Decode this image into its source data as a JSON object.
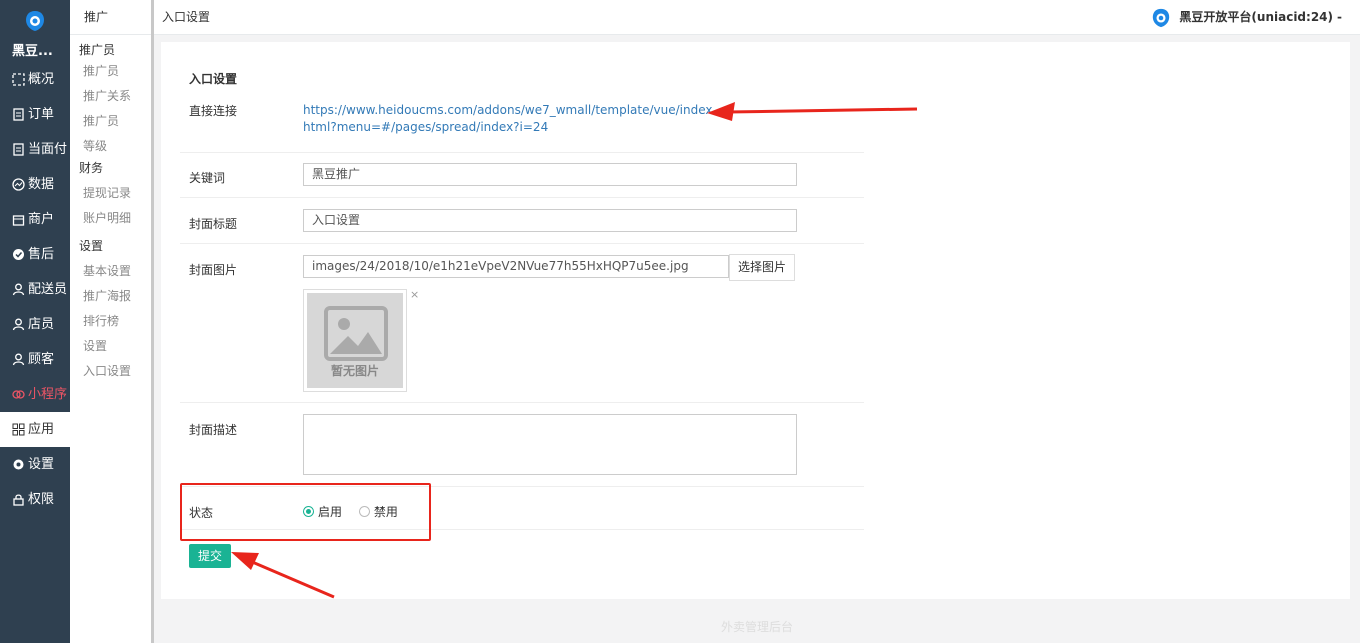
{
  "sidebar": {
    "brand": "黑豆...",
    "items": [
      {
        "label": "概况",
        "icon": "overview-icon"
      },
      {
        "label": "订单",
        "icon": "order-icon"
      },
      {
        "label": "当面付",
        "icon": "pay-icon"
      },
      {
        "label": "数据",
        "icon": "data-icon"
      },
      {
        "label": "商户",
        "icon": "store-icon"
      },
      {
        "label": "售后",
        "icon": "aftersale-icon"
      },
      {
        "label": "配送员",
        "icon": "courier-icon"
      },
      {
        "label": "店员",
        "icon": "clerk-icon"
      },
      {
        "label": "顾客",
        "icon": "customer-icon"
      },
      {
        "label": "小程序",
        "icon": "miniprogram-icon"
      },
      {
        "label": "应用",
        "icon": "apps-icon"
      },
      {
        "label": "设置",
        "icon": "gear-icon"
      },
      {
        "label": "权限",
        "icon": "lock-icon"
      }
    ]
  },
  "subnav": {
    "head": "推广",
    "groups": [
      {
        "title": "推广员",
        "links": [
          "推广员",
          "推广关系",
          "推广员等级"
        ]
      },
      {
        "title": "财务",
        "links": [
          "提现记录",
          "账户明细"
        ]
      },
      {
        "title": "设置",
        "links": [
          "基本设置",
          "推广海报",
          "排行榜设置",
          "入口设置"
        ]
      }
    ]
  },
  "topbar": {
    "breadcrumb": "入口设置",
    "account": "黑豆开放平台(uniacid:24)",
    "account_caret": "-"
  },
  "form": {
    "section_title": "入口设置",
    "direct_link_label": "直接连接",
    "direct_link": "https://www.heidoucms.com/addons/we7_wmall/template/vue/index.html?menu=#/pages/spread/index?i=24",
    "keyword_label": "关键词",
    "keyword_value": "黑豆推广",
    "cover_title_label": "封面标题",
    "cover_title_value": "入口设置",
    "cover_image_label": "封面图片",
    "cover_image_value": "images/24/2018/10/e1h21eVpeV2NVue77h55HxHQP7u5ee.jpg",
    "choose_image_button": "选择图片",
    "no_image_text": "暂无图片",
    "remove_mark": "×",
    "cover_desc_label": "封面描述",
    "cover_desc_value": "",
    "status_label": "状态",
    "status_options": [
      "启用",
      "禁用"
    ],
    "status_selected": "启用",
    "submit_label": "提交"
  },
  "footer": "外卖管理后台",
  "colors": {
    "sidebar_bg": "#2f4050",
    "primary": "#1ab394",
    "annotation": "#e8251c",
    "active_red": "#ed5565"
  }
}
